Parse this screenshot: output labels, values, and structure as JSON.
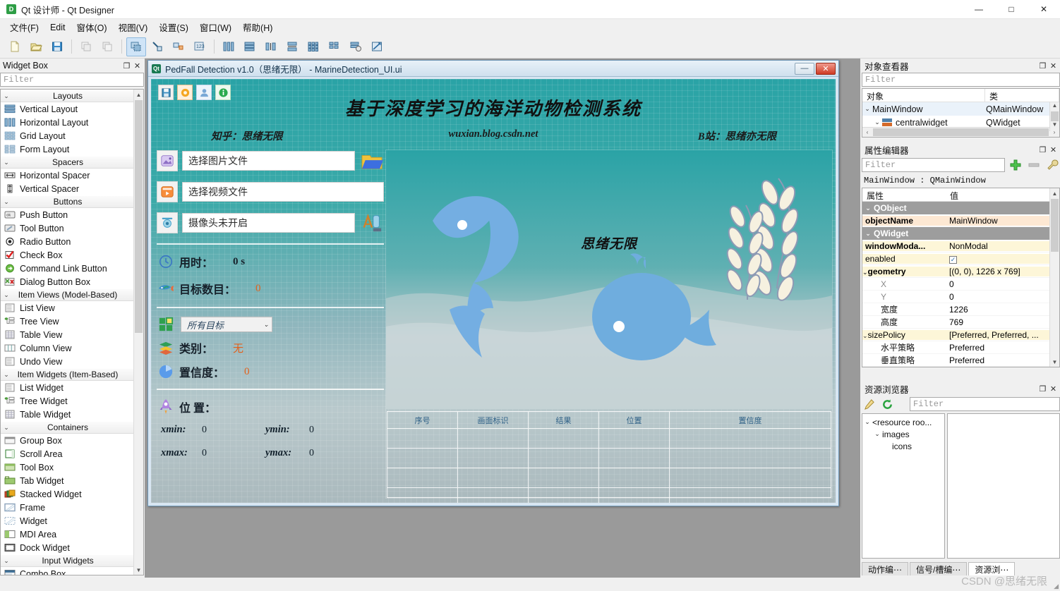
{
  "titlebar": {
    "icon": "qt-designer-icon",
    "title": "Qt 设计师 - Qt Designer",
    "minimize": "—",
    "maximize": "□",
    "close": "✕"
  },
  "menubar": {
    "items": [
      {
        "label": "文件(F)",
        "name": "menu-file"
      },
      {
        "label": "Edit",
        "name": "menu-edit"
      },
      {
        "label": "窗体(O)",
        "name": "menu-form"
      },
      {
        "label": "视图(V)",
        "name": "menu-view"
      },
      {
        "label": "设置(S)",
        "name": "menu-settings"
      },
      {
        "label": "窗口(W)",
        "name": "menu-window"
      },
      {
        "label": "帮助(H)",
        "name": "menu-help"
      }
    ]
  },
  "toolbar": {
    "buttons": [
      {
        "name": "new-form-button",
        "icon": "new-document-icon"
      },
      {
        "name": "open-form-button",
        "icon": "open-folder-icon"
      },
      {
        "name": "save-form-button",
        "icon": "save-disk-icon"
      },
      {
        "name": "undo-button",
        "icon": "undo-icon"
      },
      {
        "name": "redo-button",
        "icon": "redo-icon"
      },
      {
        "name": "edit-widgets-button",
        "icon": "edit-widgets-icon"
      },
      {
        "name": "edit-signals-slots-button",
        "icon": "signal-slot-icon"
      },
      {
        "name": "edit-buddies-button",
        "icon": "buddy-icon"
      },
      {
        "name": "edit-tab-order-button",
        "icon": "tab-order-icon"
      },
      {
        "name": "layout-horizontal-button",
        "icon": "layout-horizontal-icon"
      },
      {
        "name": "layout-vertical-button",
        "icon": "layout-vertical-icon"
      },
      {
        "name": "layout-splitter-h-button",
        "icon": "splitter-horizontal-icon"
      },
      {
        "name": "layout-splitter-v-button",
        "icon": "splitter-vertical-icon"
      },
      {
        "name": "layout-grid-button",
        "icon": "layout-grid-icon"
      },
      {
        "name": "layout-form-button",
        "icon": "layout-form-icon"
      },
      {
        "name": "break-layout-button",
        "icon": "break-layout-icon"
      },
      {
        "name": "adjust-size-button",
        "icon": "adjust-size-icon"
      }
    ]
  },
  "widget_box": {
    "header": "Widget Box",
    "float_btn": "❐",
    "close_btn": "✕",
    "filter_placeholder": "Filter",
    "groups": [
      {
        "label": "Layouts",
        "items": [
          {
            "label": "Vertical Layout",
            "icon": "vertical-layout-icon"
          },
          {
            "label": "Horizontal Layout",
            "icon": "horizontal-layout-icon"
          },
          {
            "label": "Grid Layout",
            "icon": "grid-layout-icon"
          },
          {
            "label": "Form Layout",
            "icon": "form-layout-icon"
          }
        ]
      },
      {
        "label": "Spacers",
        "items": [
          {
            "label": "Horizontal Spacer",
            "icon": "horizontal-spacer-icon"
          },
          {
            "label": "Vertical Spacer",
            "icon": "vertical-spacer-icon"
          }
        ]
      },
      {
        "label": "Buttons",
        "items": [
          {
            "label": "Push Button",
            "icon": "push-button-icon"
          },
          {
            "label": "Tool Button",
            "icon": "tool-button-icon"
          },
          {
            "label": "Radio Button",
            "icon": "radio-button-icon"
          },
          {
            "label": "Check Box",
            "icon": "check-box-icon"
          },
          {
            "label": "Command Link Button",
            "icon": "command-link-icon"
          },
          {
            "label": "Dialog Button Box",
            "icon": "dialog-button-box-icon"
          }
        ]
      },
      {
        "label": "Item Views (Model-Based)",
        "items": [
          {
            "label": "List View",
            "icon": "list-view-icon"
          },
          {
            "label": "Tree View",
            "icon": "tree-view-icon"
          },
          {
            "label": "Table View",
            "icon": "table-view-icon"
          },
          {
            "label": "Column View",
            "icon": "column-view-icon"
          },
          {
            "label": "Undo View",
            "icon": "undo-view-icon"
          }
        ]
      },
      {
        "label": "Item Widgets (Item-Based)",
        "items": [
          {
            "label": "List Widget",
            "icon": "list-widget-icon"
          },
          {
            "label": "Tree Widget",
            "icon": "tree-widget-icon"
          },
          {
            "label": "Table Widget",
            "icon": "table-widget-icon"
          }
        ]
      },
      {
        "label": "Containers",
        "items": [
          {
            "label": "Group Box",
            "icon": "group-box-icon"
          },
          {
            "label": "Scroll Area",
            "icon": "scroll-area-icon"
          },
          {
            "label": "Tool Box",
            "icon": "tool-box-icon"
          },
          {
            "label": "Tab Widget",
            "icon": "tab-widget-icon"
          },
          {
            "label": "Stacked Widget",
            "icon": "stacked-widget-icon"
          },
          {
            "label": "Frame",
            "icon": "frame-icon"
          },
          {
            "label": "Widget",
            "icon": "widget-icon"
          },
          {
            "label": "MDI Area",
            "icon": "mdi-area-icon"
          },
          {
            "label": "Dock Widget",
            "icon": "dock-widget-icon"
          }
        ]
      },
      {
        "label": "Input Widgets",
        "items": [
          {
            "label": "Combo Box",
            "icon": "combo-box-icon"
          }
        ]
      }
    ]
  },
  "form": {
    "titlebar": {
      "icon": "qt-form-icon",
      "title": "PedFall Detection v1.0（思绪无限） - MarineDetection_UI.ui",
      "minimize": "—",
      "close": "✕"
    },
    "toolbuttons": [
      {
        "name": "save-icon-button",
        "icon": "floppy-save-icon"
      },
      {
        "name": "settings-icon-button",
        "icon": "orange-gear-icon"
      },
      {
        "name": "user-icon-button",
        "icon": "user-avatar-icon"
      },
      {
        "name": "info-icon-button",
        "icon": "info-circle-icon"
      }
    ],
    "banner": {
      "title": "基于深度学习的海洋动物检测系统",
      "left": "知乎：思绪无限",
      "middle": "wuxian.blog.csdn.net",
      "right": "B站：思绪亦无限"
    },
    "controls": {
      "image_icon": "picture-icon",
      "image_value": "选择图片文件",
      "image_open_icon": "open-folder-button-icon",
      "video_icon": "video-clapper-icon",
      "video_value": "选择视频文件",
      "camera_icon": "camera-icon",
      "camera_value": "摄像头未开启",
      "camera_action_icon": "model-select-icon"
    },
    "stats": {
      "time_icon": "clock-icon",
      "time_label": "用时：",
      "time_value": "0 s",
      "count_icon": "fish-icon",
      "count_label": "目标数目：",
      "count_value": "0",
      "target_icon": "grid-squares-icon",
      "target_combo_value": "所有目标",
      "target_combo_caret": "⌄",
      "class_icon": "layers-icon",
      "class_label": "类别：",
      "class_value": "无",
      "conf_icon": "pie-chart-icon",
      "conf_label": "置信度：",
      "conf_value": "0"
    },
    "position": {
      "icon": "rocket-icon",
      "label": "位 置：",
      "fields": [
        {
          "key": "xmin:",
          "value": "0"
        },
        {
          "key": "ymin:",
          "value": "0"
        },
        {
          "key": "xmax:",
          "value": "0"
        },
        {
          "key": "ymax:",
          "value": "0"
        }
      ]
    },
    "preview": {
      "art_text": "思绪无限",
      "art_items": [
        "fish-illustration",
        "whale-illustration",
        "wheat-illustration"
      ]
    },
    "result_table": {
      "columns": [
        "序号",
        "画面标识",
        "结果",
        "位置",
        "置信度"
      ],
      "empty_rows": 4
    }
  },
  "object_inspector": {
    "header": "对象查看器",
    "float_btn": "❐",
    "close_btn": "✕",
    "filter_placeholder": "Filter",
    "columns": [
      "对象",
      "类"
    ],
    "rows": [
      {
        "name": "MainWindow",
        "class": "QMainWindow",
        "chev": "⌄",
        "indent": 0,
        "icon": ""
      },
      {
        "name": "centralwidget",
        "class": "QWidget",
        "chev": "⌄",
        "indent": 1,
        "icon": "widget-icon"
      }
    ],
    "scroll_left": "‹",
    "scroll_right": "›"
  },
  "property_editor": {
    "header": "属性编辑器",
    "float_btn": "❐",
    "close_btn": "✕",
    "filter_placeholder": "Filter",
    "add_icon": "plus-icon",
    "remove_icon": "minus-icon",
    "config_icon": "wrench-icon",
    "object_line": "MainWindow : QMainWindow",
    "columns": [
      "属性",
      "值"
    ],
    "rows": [
      {
        "kind": "group",
        "key": "QObject",
        "value": "",
        "chev": "⌄"
      },
      {
        "kind": "high",
        "key": "objectName",
        "value": "MainWindow",
        "bold": true
      },
      {
        "kind": "group",
        "key": "QWidget",
        "value": "",
        "chev": "⌄"
      },
      {
        "kind": "yel",
        "key": "windowModa...",
        "value": "NonModal",
        "bold": true
      },
      {
        "kind": "yel",
        "key": "enabled",
        "value": "checkbox"
      },
      {
        "kind": "yel",
        "key": "geometry",
        "value": "[(0, 0), 1226 x 769]",
        "bold": true,
        "chev": "⌄"
      },
      {
        "kind": "sub",
        "key": "X",
        "value": "0"
      },
      {
        "kind": "sub",
        "key": "Y",
        "value": "0"
      },
      {
        "kind": "sub2",
        "key": "宽度",
        "value": "1226"
      },
      {
        "kind": "sub2",
        "key": "高度",
        "value": "769"
      },
      {
        "kind": "yel",
        "key": "sizePolicy",
        "value": "[Preferred, Preferred, ...",
        "chev": "⌄"
      },
      {
        "kind": "sub2",
        "key": "水平策略",
        "value": "Preferred"
      },
      {
        "kind": "sub2",
        "key": "垂直策略",
        "value": "Preferred"
      }
    ]
  },
  "resource_browser": {
    "header": "资源浏览器",
    "float_btn": "❐",
    "close_btn": "✕",
    "edit_icon": "pencil-icon",
    "reload_icon": "reload-icon",
    "filter_placeholder": "Filter",
    "tree": [
      {
        "label": "<resource roo...",
        "chev": "⌄",
        "indent": 0
      },
      {
        "label": "images",
        "chev": "⌄",
        "indent": 1
      },
      {
        "label": "icons",
        "chev": "",
        "indent": 2
      }
    ],
    "tabs": [
      {
        "label": "动作编⋯",
        "active": false
      },
      {
        "label": "信号/槽编⋯",
        "active": false
      },
      {
        "label": "资源浏⋯",
        "active": true
      }
    ]
  },
  "watermark": "CSDN @思绪无限"
}
